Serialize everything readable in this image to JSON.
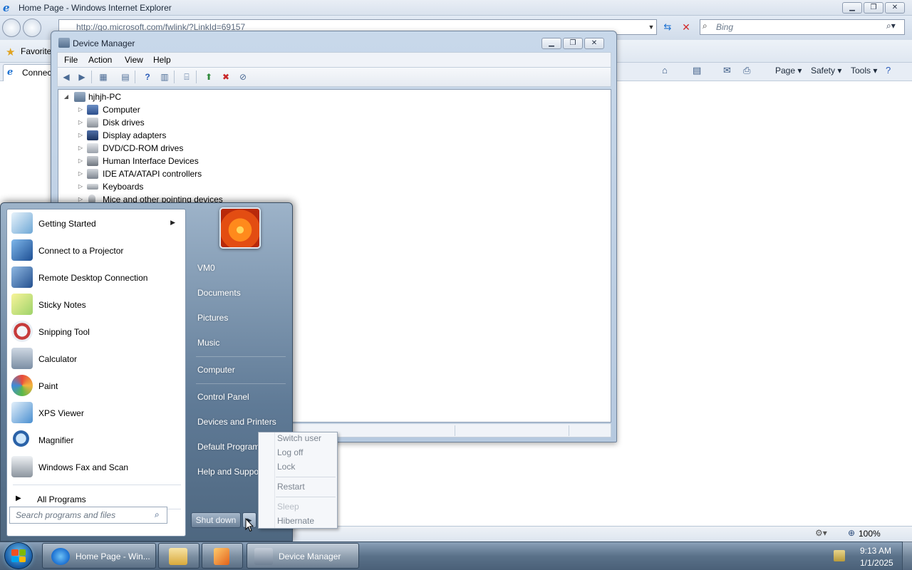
{
  "ie": {
    "title": "Home Page - Windows Internet Explorer",
    "address": "http://go.microsoft.com/fwlink/?LinkId=69157",
    "search_placeholder": "Bing",
    "favorites_label": "Favorite",
    "tab_label": "Connec",
    "commands": {
      "page": "Page ▾",
      "safety": "Safety ▾",
      "tools": "Tools ▾"
    },
    "zoom": "100%"
  },
  "device_manager": {
    "title": "Device Manager",
    "menu": [
      "File",
      "Action",
      "View",
      "Help"
    ],
    "root": "hjhjh-PC",
    "tree_items": [
      "Computer",
      "Disk drives",
      "Display adapters",
      "DVD/CD-ROM drives",
      "Human Interface Devices",
      "IDE ATA/ATAPI controllers",
      "Keyboards",
      "Mice and other pointing devices"
    ]
  },
  "start_menu": {
    "programs": [
      {
        "label": "Getting Started",
        "icon": "getting-started-icon",
        "has_submenu": true
      },
      {
        "label": "Connect to a Projector",
        "icon": "projector-icon"
      },
      {
        "label": "Remote Desktop Connection",
        "icon": "remote-desktop-icon"
      },
      {
        "label": "Sticky Notes",
        "icon": "sticky-notes-icon"
      },
      {
        "label": "Snipping Tool",
        "icon": "snipping-tool-icon"
      },
      {
        "label": "Calculator",
        "icon": "calculator-icon"
      },
      {
        "label": "Paint",
        "icon": "paint-icon"
      },
      {
        "label": "XPS Viewer",
        "icon": "xps-viewer-icon"
      },
      {
        "label": "Magnifier",
        "icon": "magnifier-icon"
      },
      {
        "label": "Windows Fax and Scan",
        "icon": "fax-scan-icon"
      }
    ],
    "all_programs": "All Programs",
    "search_placeholder": "Search programs and files",
    "right_items": [
      "VM0",
      "Documents",
      "Pictures",
      "Music",
      "Computer",
      "Control Panel",
      "Devices and Printers",
      "Default Programs",
      "Help and Support"
    ],
    "shutdown_label": "Shut down",
    "shutdown_options": [
      {
        "label": "Switch user",
        "enabled": true
      },
      {
        "label": "Log off",
        "enabled": true
      },
      {
        "label": "Lock",
        "enabled": true
      },
      {
        "label": "Restart",
        "enabled": true
      },
      {
        "label": "Sleep",
        "enabled": false
      },
      {
        "label": "Hibernate",
        "enabled": true
      }
    ]
  },
  "taskbar": {
    "tasks": [
      "Home Page - Win...",
      "Device Manager"
    ],
    "time": "9:13 AM",
    "date": "1/1/2025"
  },
  "colors": {
    "taskbar": "#5a7189",
    "start_menu_right": "#5f7a96",
    "accent": "#1a6fd1"
  }
}
